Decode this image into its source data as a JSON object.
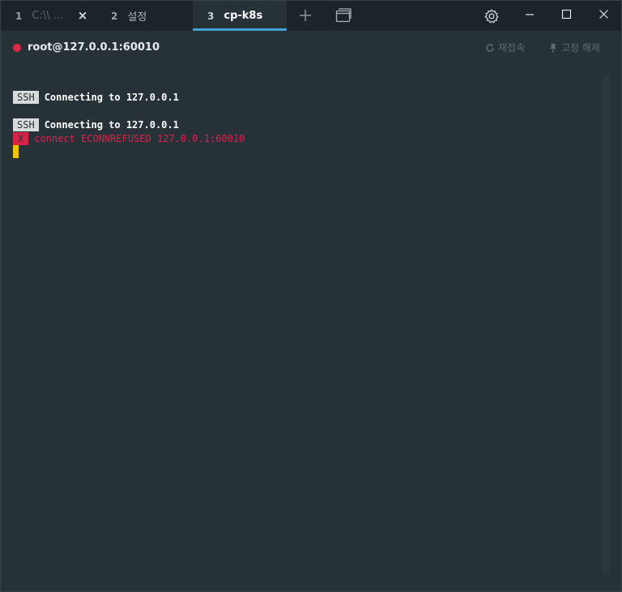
{
  "tabs": [
    {
      "number": "1",
      "title": "C:\\\\ ...",
      "close": "×"
    },
    {
      "number": "2",
      "title": "설정"
    },
    {
      "number": "3",
      "title": "cp-k8s"
    }
  ],
  "session": {
    "host": "root@127.0.0.1:60010",
    "status_color": "#dc2a49",
    "reconnect_label": "재접속",
    "unpin_label": "고정 해제"
  },
  "terminal": {
    "lines": [
      {
        "badge": "SSH",
        "text": "Connecting to 127.0.0.1"
      },
      {
        "badge": "SSH",
        "text": "Connecting to 127.0.0.1"
      },
      {
        "badge": "X",
        "text": "connect ECONNREFUSED 127.0.0.1:60010"
      }
    ],
    "cursor_color": "#f2c200",
    "error_color": "#d9244a"
  },
  "icons": {
    "new_tab": "plus-icon",
    "window_selector": "windows-icon",
    "settings": "gear-icon",
    "minimize": "minimize-icon",
    "maximize": "maximize-icon",
    "close": "close-icon",
    "reconnect": "refresh-icon",
    "unpin": "pin-icon"
  }
}
